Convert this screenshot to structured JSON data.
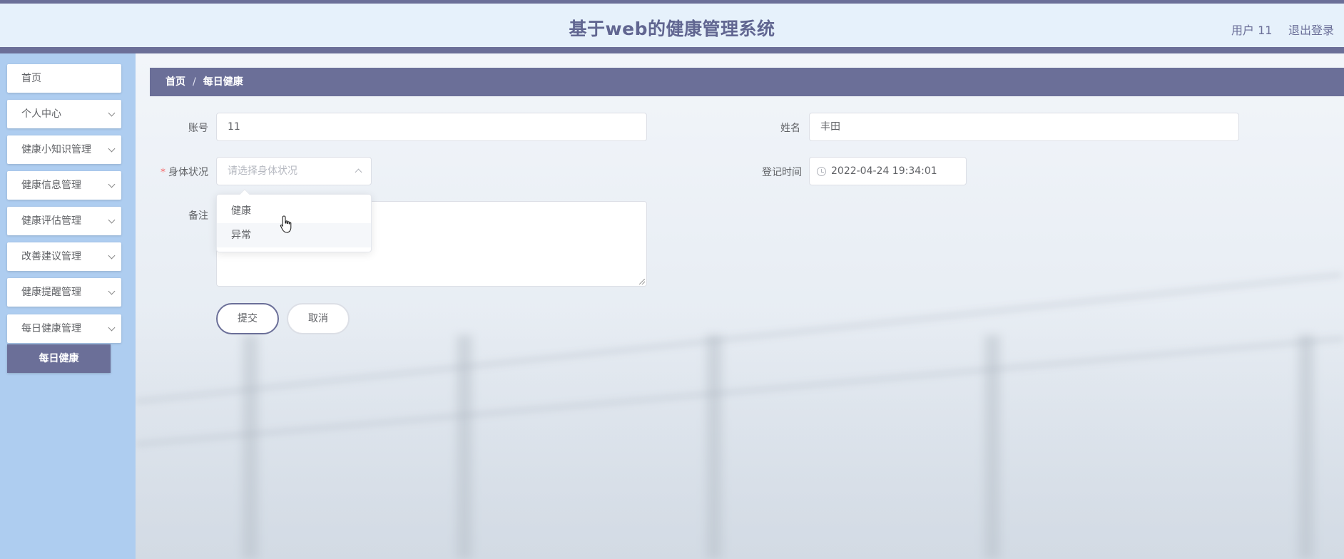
{
  "header": {
    "title": "基于web的健康管理系统",
    "user_label": "用户 11",
    "logout_label": "退出登录"
  },
  "sidebar": {
    "items": [
      {
        "label": "首页",
        "has_children": false
      },
      {
        "label": "个人中心",
        "has_children": true
      },
      {
        "label": "健康小知识管理",
        "has_children": true
      },
      {
        "label": "健康信息管理",
        "has_children": true
      },
      {
        "label": "健康评估管理",
        "has_children": true
      },
      {
        "label": "改善建议管理",
        "has_children": true
      },
      {
        "label": "健康提醒管理",
        "has_children": true
      },
      {
        "label": "每日健康管理",
        "has_children": true
      }
    ],
    "active_submenu": "每日健康"
  },
  "breadcrumb": {
    "home": "首页",
    "separator": "/",
    "current": "每日健康"
  },
  "form": {
    "account": {
      "label": "账号",
      "value": "11"
    },
    "name": {
      "label": "姓名",
      "value": "丰田"
    },
    "health_status": {
      "label": "身体状况",
      "required_mark": "*",
      "placeholder": "请选择身体状况",
      "options": [
        "健康",
        "异常"
      ],
      "hovered_option": "异常"
    },
    "register_time": {
      "label": "登记时间",
      "value": "2022-04-24 19:34:01"
    },
    "remark": {
      "label": "备注",
      "value": ""
    },
    "submit_label": "提交",
    "cancel_label": "取消"
  },
  "colors": {
    "primary": "#6b6f98",
    "sidebar_bg": "#aecdf0",
    "header_bg": "#e6f1fb",
    "required": "#f56c6c"
  }
}
